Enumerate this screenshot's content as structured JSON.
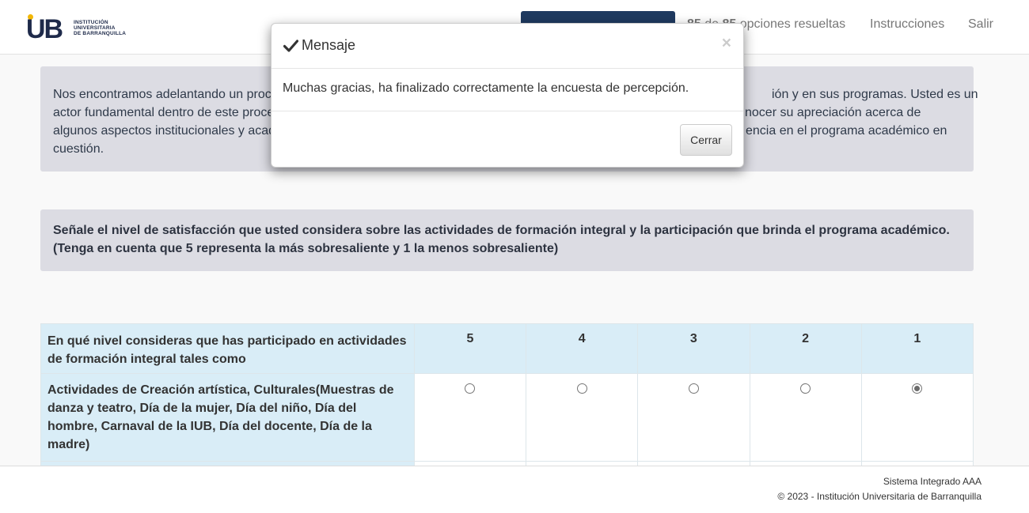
{
  "header": {
    "logo_text": [
      "INSTITUCIÓN",
      "UNIVERSITARIA",
      "DE BARRANQUILLA"
    ],
    "logo_mark": "UB",
    "progress_current": "85",
    "progress_sep": "de",
    "progress_total": "85",
    "progress_suffix": "opciones resueltas",
    "nav_instructions": "Instrucciones",
    "nav_logout": "Salir"
  },
  "intro": {
    "lines": [
      "Nos encontramos adelantando un proc",
      "ión y en sus programas. Usted es un",
      "actor fundamental dentro de este proce",
      "nocer su apreciación acerca de",
      "algunos aspectos institucionales y acad",
      "encia en el programa académico en",
      "cuestión."
    ]
  },
  "question": {
    "line1": "Señale el nivel de satisfacción que usted considera sobre las actividades de formación integral y la participación que brinda el programa académico.",
    "line2": "(Tenga en cuenta que 5 representa la más sobresaliente y 1 la menos sobresaliente)"
  },
  "table": {
    "header_question": "En qué nivel consideras que has participado en actividades de formación integral tales como",
    "scale": [
      "5",
      "4",
      "3",
      "2",
      "1"
    ],
    "row1_label": "Actividades de Creación artística, Culturales(Muestras de danza y teatro, Día de la mujer, Día del niño, Día del hombre, Carnaval de la IUB, Día del docente, Día de la madre)",
    "row1_selected": "1"
  },
  "footer": {
    "line1": "Sistema Integrado AAA",
    "line2": "© 2023 - Institución Universitaria de Barranquilla"
  },
  "modal": {
    "title": "Mensaje",
    "close_symbol": "×",
    "body": "Muchas gracias, ha finalizado correctamente la encuesta de percepción.",
    "button": "Cerrar"
  },
  "colors": {
    "navy": "#1f3a60",
    "accent_yellow": "#f2b705",
    "panel_gray": "#dcdce3",
    "table_header_blue": "#d9edf7"
  }
}
